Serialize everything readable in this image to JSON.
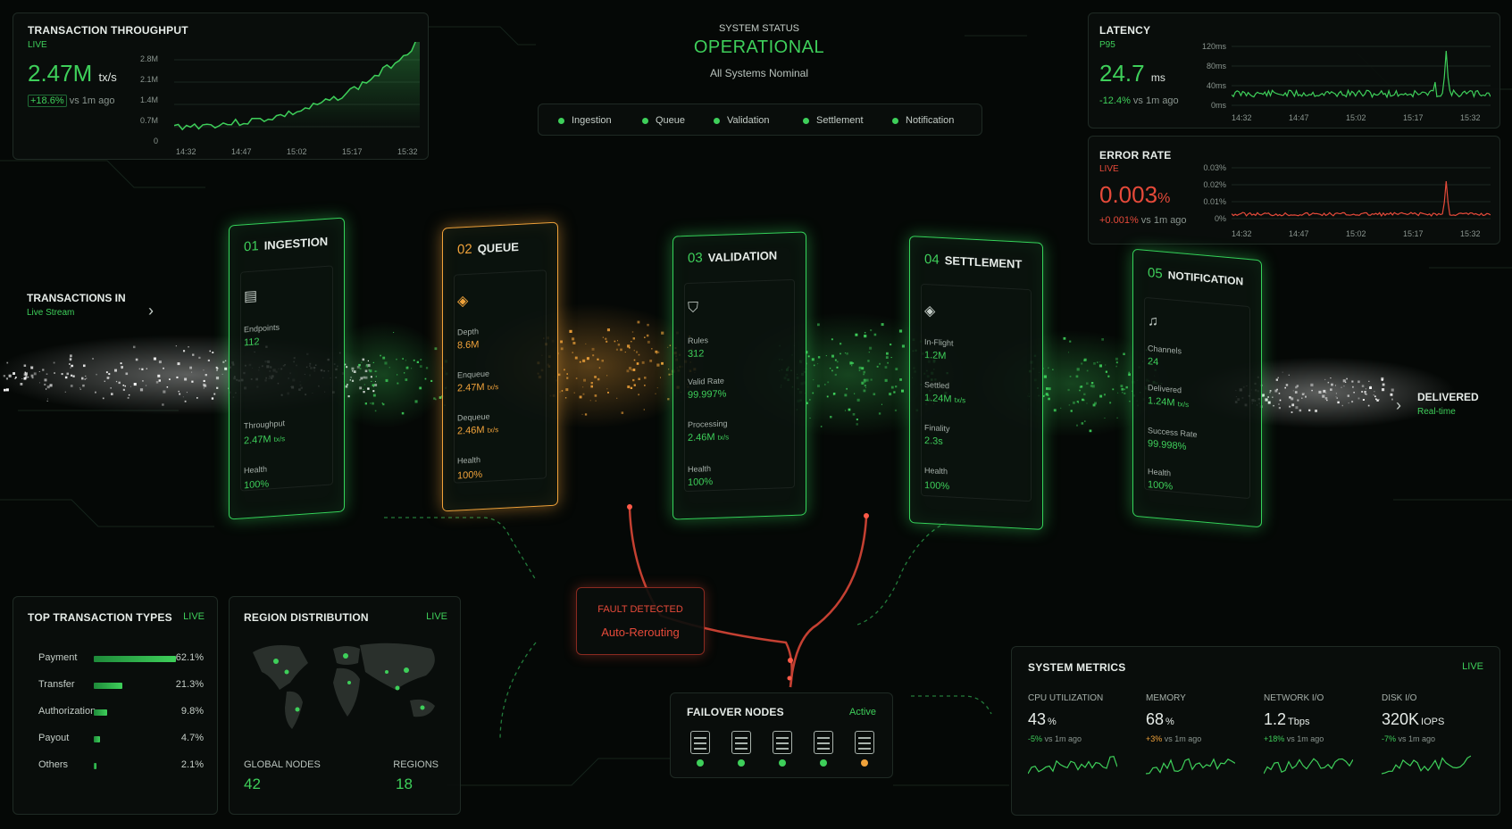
{
  "throughput": {
    "title": "TRANSACTION THROUGHPUT",
    "status": "LIVE",
    "value": "2.47M",
    "unit": "tx/s",
    "delta": "+18.6%",
    "delta_note": "vs 1m ago",
    "y_ticks": [
      "2.8M",
      "2.1M",
      "1.4M",
      "0.7M",
      "0"
    ],
    "x_ticks": [
      "14:32",
      "14:47",
      "15:02",
      "15:17",
      "15:32"
    ]
  },
  "system_status": {
    "label": "SYSTEM STATUS",
    "state": "OPERATIONAL",
    "note": "All Systems Nominal",
    "pipeline": [
      "Ingestion",
      "Queue",
      "Validation",
      "Settlement",
      "Notification"
    ]
  },
  "latency": {
    "title": "LATENCY",
    "sub": "P95",
    "value": "24.7",
    "unit": "ms",
    "delta": "-12.4%",
    "delta_note": "vs 1m ago",
    "y_ticks": [
      "120ms",
      "80ms",
      "40ms",
      "0ms"
    ],
    "x_ticks": [
      "14:32",
      "14:47",
      "15:02",
      "15:17",
      "15:32"
    ]
  },
  "error_rate": {
    "title": "ERROR RATE",
    "status": "LIVE",
    "value": "0.003",
    "unit": "%",
    "delta": "+0.001%",
    "delta_note": "vs 1m ago",
    "y_ticks": [
      "0.03%",
      "0.02%",
      "0.01%",
      "0%"
    ],
    "x_ticks": [
      "14:32",
      "14:47",
      "15:02",
      "15:17",
      "15:32"
    ]
  },
  "flow": {
    "in_label": "TRANSACTIONS IN",
    "in_sub": "Live Stream",
    "out_label": "DELIVERED",
    "out_sub": "Real-time"
  },
  "stages": [
    {
      "num": "01",
      "name": "INGESTION",
      "icon": "document-icon",
      "metrics": [
        {
          "label": "Endpoints",
          "value": "112",
          "unit": ""
        },
        {
          "label": "Throughput",
          "value": "2.47M",
          "unit": "tx/s"
        },
        {
          "label": "Health",
          "value": "100%",
          "unit": ""
        }
      ]
    },
    {
      "num": "02",
      "name": "QUEUE",
      "icon": "layers-icon",
      "metrics": [
        {
          "label": "Depth",
          "value": "8.6M",
          "unit": ""
        },
        {
          "label": "Enqueue",
          "value": "2.47M",
          "unit": "tx/s"
        },
        {
          "label": "Dequeue",
          "value": "2.46M",
          "unit": "tx/s"
        },
        {
          "label": "Health",
          "value": "100%",
          "unit": ""
        }
      ]
    },
    {
      "num": "03",
      "name": "VALIDATION",
      "icon": "shield-icon",
      "metrics": [
        {
          "label": "Rules",
          "value": "312",
          "unit": ""
        },
        {
          "label": "Valid Rate",
          "value": "99.997%",
          "unit": ""
        },
        {
          "label": "Processing",
          "value": "2.46M",
          "unit": "tx/s"
        },
        {
          "label": "Health",
          "value": "100%",
          "unit": ""
        }
      ]
    },
    {
      "num": "04",
      "name": "SETTLEMENT",
      "icon": "layers-icon",
      "metrics": [
        {
          "label": "In-Flight",
          "value": "1.2M",
          "unit": ""
        },
        {
          "label": "Settled",
          "value": "1.24M",
          "unit": "tx/s"
        },
        {
          "label": "Finality",
          "value": "2.3s",
          "unit": ""
        },
        {
          "label": "Health",
          "value": "100%",
          "unit": ""
        }
      ]
    },
    {
      "num": "05",
      "name": "NOTIFICATION",
      "icon": "bell-icon",
      "metrics": [
        {
          "label": "Channels",
          "value": "24",
          "unit": ""
        },
        {
          "label": "Delivered",
          "value": "1.24M",
          "unit": "tx/s"
        },
        {
          "label": "Success Rate",
          "value": "99.998%",
          "unit": ""
        },
        {
          "label": "Health",
          "value": "100%",
          "unit": ""
        }
      ]
    }
  ],
  "fault": {
    "title": "FAULT DETECTED",
    "action": "Auto-Rerouting"
  },
  "failover": {
    "title": "FAILOVER NODES",
    "status": "Active",
    "node_states": [
      "ok",
      "ok",
      "ok",
      "ok",
      "warn"
    ]
  },
  "top_types": {
    "title": "TOP TRANSACTION TYPES",
    "status": "LIVE",
    "rows": [
      {
        "label": "Payment",
        "pct": "62.1%",
        "value": 62.1
      },
      {
        "label": "Transfer",
        "pct": "21.3%",
        "value": 21.3
      },
      {
        "label": "Authorization",
        "pct": "9.8%",
        "value": 9.8
      },
      {
        "label": "Payout",
        "pct": "4.7%",
        "value": 4.7
      },
      {
        "label": "Others",
        "pct": "2.1%",
        "value": 2.1
      }
    ]
  },
  "region": {
    "title": "REGION DISTRIBUTION",
    "status": "LIVE",
    "nodes_label": "GLOBAL NODES",
    "nodes_value": "42",
    "regions_label": "REGIONS",
    "regions_value": "18"
  },
  "metrics": {
    "title": "SYSTEM METRICS",
    "status": "LIVE",
    "items": [
      {
        "label": "CPU UTILIZATION",
        "value": "43",
        "unit": "%",
        "delta": "-5%",
        "note": "vs 1m ago",
        "dir": "down"
      },
      {
        "label": "MEMORY",
        "value": "68",
        "unit": "%",
        "delta": "+3%",
        "note": "vs 1m ago",
        "dir": "up-warn"
      },
      {
        "label": "NETWORK I/O",
        "value": "1.2",
        "unit": "Tbps",
        "delta": "+18%",
        "note": "vs 1m ago",
        "dir": "up"
      },
      {
        "label": "DISK I/O",
        "value": "320K",
        "unit": "IOPS",
        "delta": "-7%",
        "note": "vs 1m ago",
        "dir": "down"
      }
    ]
  },
  "colors": {
    "green": "#3ecf5a",
    "orange": "#f0a23a",
    "red": "#e64a3a",
    "bg": "#050806"
  }
}
